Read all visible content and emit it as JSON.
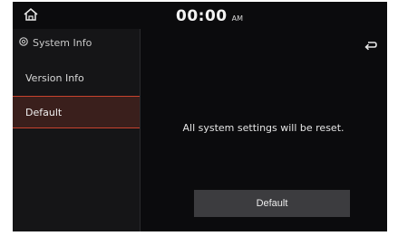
{
  "status_bar": {
    "time": "00:00",
    "ampm": "AM",
    "home_icon": "home-icon"
  },
  "sidebar": {
    "title": "System Info",
    "title_icon": "gear-icon",
    "items": [
      {
        "label": "Version Info",
        "selected": false
      },
      {
        "label": "Default",
        "selected": true
      }
    ]
  },
  "header": {
    "back_icon": "back-arrow-icon"
  },
  "main": {
    "message": "All system settings will be reset.",
    "default_button_label": "Default"
  },
  "colors": {
    "background": "#0b0b0d",
    "sidebar": "#151517",
    "selected_accent": "#c8432e",
    "selected_fill": "#3a1f1c",
    "button": "#3c3c3f"
  }
}
